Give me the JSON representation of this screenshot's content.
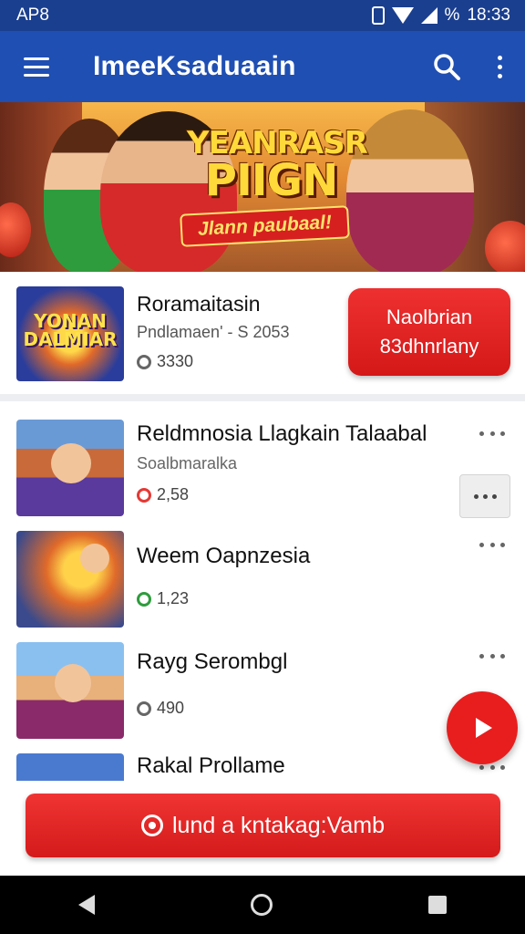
{
  "status_bar": {
    "time_left": "AP8",
    "time_right": "18:33",
    "battery": "%"
  },
  "app_bar": {
    "title": "ImeeKsaduaain",
    "icons": [
      "menu-icon",
      "search-icon",
      "more-vert-icon"
    ]
  },
  "banner": {
    "title_line1": "YEANRASR",
    "title_line2": "PIIGN",
    "ribbon": "Jlann paubaal!"
  },
  "featured": {
    "thumb_text_line1": "YONAN",
    "thumb_text_line2": "DALMIAR",
    "title": "Roramaitasin",
    "subtitle": "Pndlamaen' - S 2053",
    "count": "3330",
    "button_line1": "Naolbrian",
    "button_line2": "83dhnrlany"
  },
  "list": [
    {
      "title": "Reldmnosia Llagkain Talaabal",
      "subtitle": "Soalbmaralka",
      "count": "2,58",
      "count_icon_color": "#e53935"
    },
    {
      "title": "Weem Oapnzesia",
      "subtitle": "",
      "count": "1,23",
      "count_icon_color": "#2e9c3d"
    },
    {
      "title": "Rayg Serombgl",
      "subtitle": "",
      "count": "490",
      "count_icon_color": "#666666"
    },
    {
      "title": "Rakal Prollame",
      "subtitle": "",
      "count": "",
      "count_icon_color": "#666666"
    }
  ],
  "cta": {
    "label": "lund a kntakag:Vamb"
  },
  "colors": {
    "app_bar": "#1f4fb3",
    "status_bar": "#1b3f8f",
    "accent_red": "#e81e1e"
  }
}
